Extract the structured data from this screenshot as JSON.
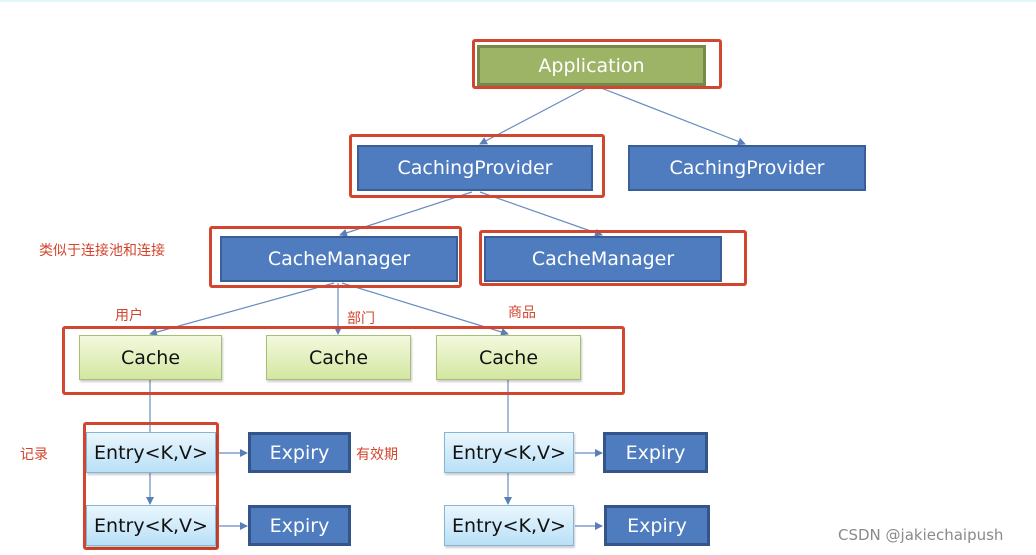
{
  "nodes": {
    "application": "Application",
    "caching_provider_1": "CachingProvider",
    "caching_provider_2": "CachingProvider",
    "cache_manager_1": "CacheManager",
    "cache_manager_2": "CacheManager",
    "cache_1": "Cache",
    "cache_2": "Cache",
    "cache_3": "Cache",
    "entry_1": "Entry<K,V>",
    "entry_2": "Entry<K,V>",
    "entry_3": "Entry<K,V>",
    "entry_4": "Entry<K,V>",
    "expiry_1": "Expiry",
    "expiry_2": "Expiry",
    "expiry_3": "Expiry",
    "expiry_4": "Expiry"
  },
  "annotations": {
    "connection_pool_note": "类似于连接池和连接",
    "user": "用户",
    "department": "部门",
    "product": "商品",
    "record": "记录",
    "validity": "有效期"
  },
  "watermark": "CSDN @jakiechaipush",
  "colors": {
    "highlight": "#d2452e",
    "provider_blue": "#4f7bbf",
    "application_green": "#9db466",
    "cache_green": "#d3e7a0",
    "entry_blue": "#b9e0f7"
  }
}
